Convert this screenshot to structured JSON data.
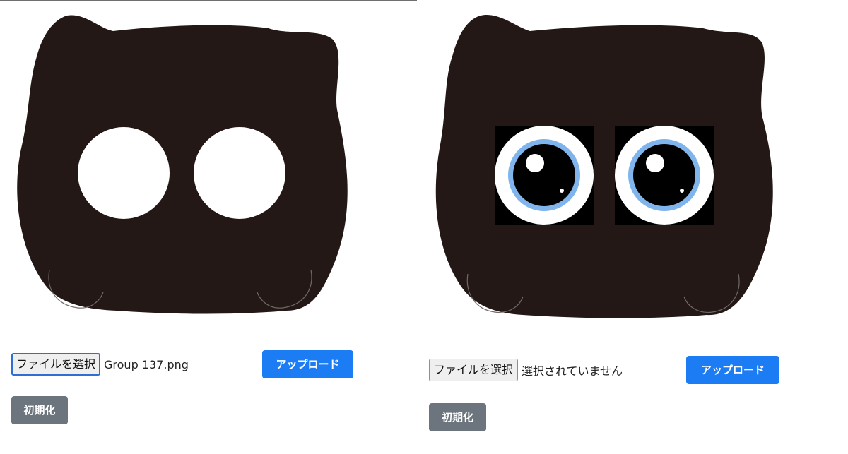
{
  "colors": {
    "cat_body": "#231816",
    "eye_blank": "#ffffff",
    "iris_ring": "#7fb4ec",
    "pupil": "#000000",
    "eye_backdrop": "#000000",
    "primary_button": "#1b7cf4",
    "secondary_button": "#6c757d"
  },
  "left_panel": {
    "image": {
      "name": "cat-face-blank-eyes",
      "eyes": "blank"
    },
    "file_input": {
      "button_label": "ファイルを選択",
      "file_name": "Group 137.png"
    },
    "upload_label": "アップロード",
    "reset_label": "初期化"
  },
  "right_panel": {
    "image": {
      "name": "cat-face-with-eyes",
      "eyes": "cartoon"
    },
    "file_input": {
      "button_label": "ファイルを選択",
      "file_name": "選択されていません"
    },
    "upload_label": "アップロード",
    "reset_label": "初期化"
  }
}
